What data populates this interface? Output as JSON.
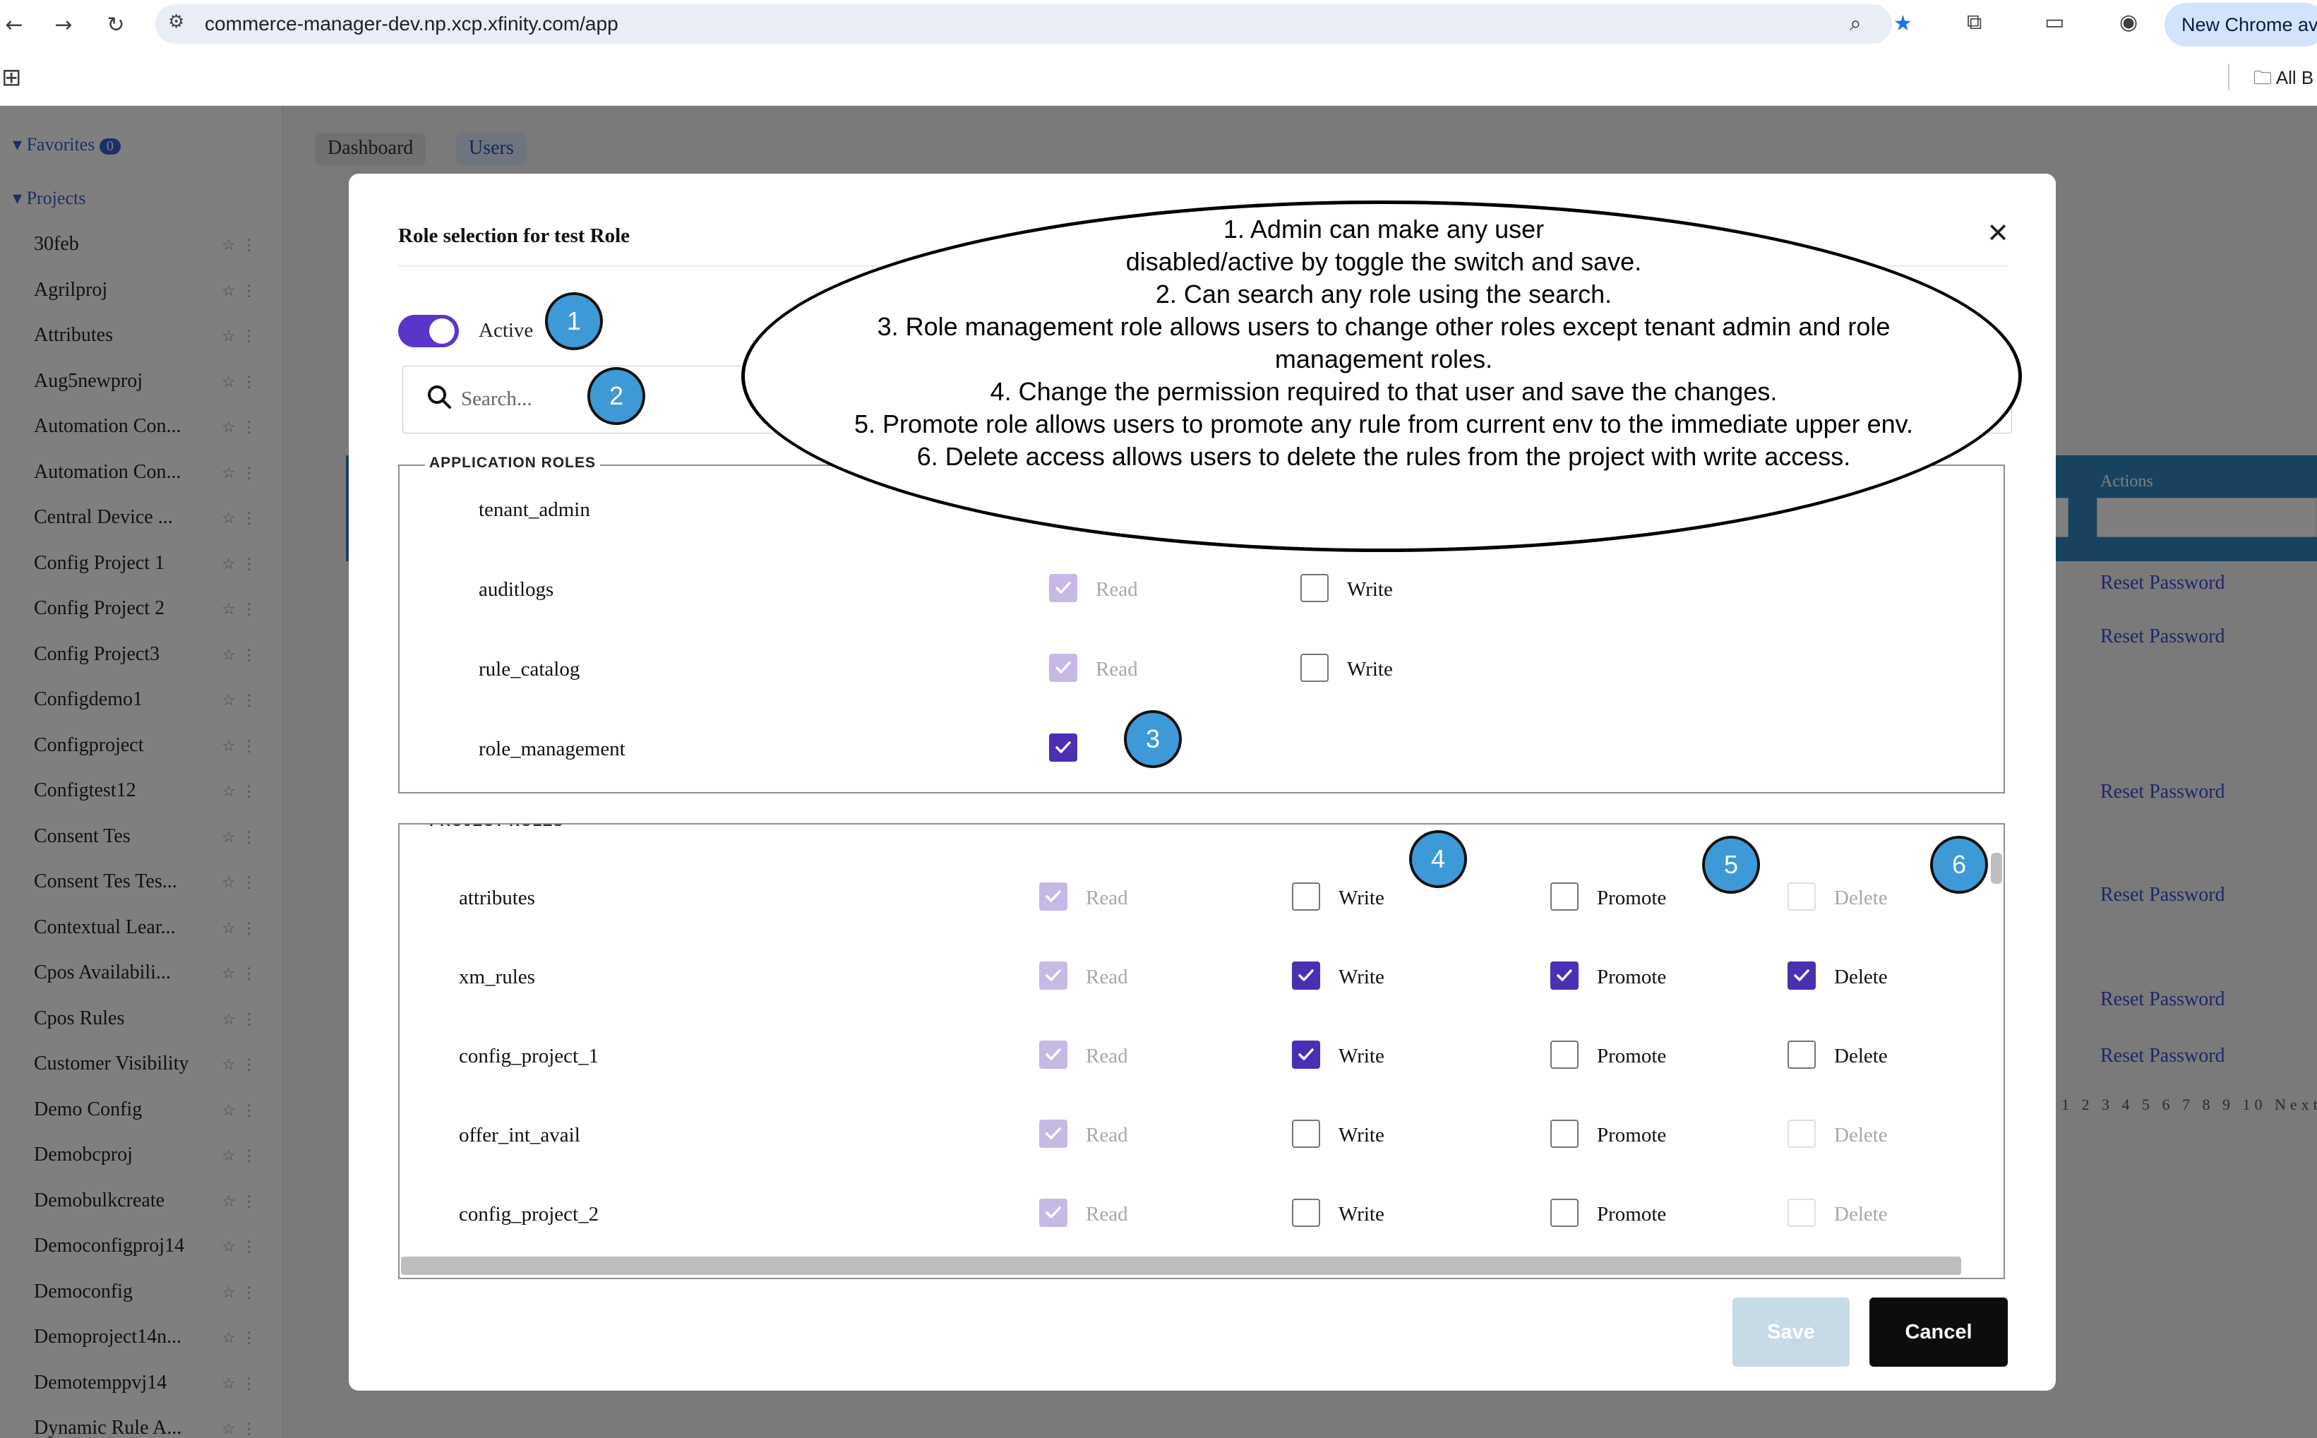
{
  "browser": {
    "url": "commerce-manager-dev.np.xcp.xfinity.com/app",
    "new_chrome_label": "New Chrome av",
    "all_bookmarks_label": "All B"
  },
  "background": {
    "sidebar": {
      "favorites_label": "Favorites",
      "favorites_count": "0",
      "projects_label": "Projects",
      "items": [
        "30feb",
        "Agrilproj",
        "Attributes",
        "Aug5newproj",
        "Automation Con...",
        "Automation Con...",
        "Central Device ...",
        "Config Project 1",
        "Config Project 2",
        "Config Project3",
        "Configdemo1",
        "Configproject",
        "Configtest12",
        "Consent Tes",
        "Consent Tes Tes...",
        "Contextual Lear...",
        "Cpos Availabili...",
        "Cpos Rules",
        "Customer Visibility",
        "Demo Config",
        "Demobcproj",
        "Demobulkcreate",
        "Democonfigproj14",
        "Democonfig",
        "Demoproject14n...",
        "Demotemppvj14",
        "Dynamic Rule A..."
      ]
    },
    "tabs": [
      "Dashboard",
      "Users"
    ],
    "actions_header": "Actions",
    "reset_link": "Reset Password",
    "pager": "1 2 3 4 5 6 7 8 9 10  Next"
  },
  "modal": {
    "title": "Role selection for test Role",
    "active_label": "Active",
    "search_placeholder": "Search...",
    "application_roles_legend": "APPLICATION ROLES",
    "project_roles_legend": "PROJECT ROLES",
    "labels": {
      "read": "Read",
      "write": "Write",
      "promote": "Promote",
      "delete": "Delete"
    },
    "application_roles": [
      {
        "name": "tenant_admin"
      },
      {
        "name": "auditlogs",
        "read": "checked-disabled",
        "write": "unchecked"
      },
      {
        "name": "rule_catalog",
        "read": "checked-disabled",
        "write": "unchecked"
      },
      {
        "name": "role_management",
        "single": "checked"
      }
    ],
    "project_roles": [
      {
        "name": "attributes",
        "read": "checked-disabled",
        "write": "unchecked",
        "promote": "unchecked",
        "delete": "disabled"
      },
      {
        "name": "xm_rules",
        "read": "checked-disabled",
        "write": "checked",
        "promote": "checked",
        "delete": "checked"
      },
      {
        "name": "config_project_1",
        "read": "checked-disabled",
        "write": "checked",
        "promote": "unchecked",
        "delete": "unchecked"
      },
      {
        "name": "offer_int_avail",
        "read": "checked-disabled",
        "write": "unchecked",
        "promote": "unchecked",
        "delete": "disabled"
      },
      {
        "name": "config_project_2",
        "read": "checked-disabled",
        "write": "unchecked",
        "promote": "unchecked",
        "delete": "disabled"
      }
    ],
    "save_label": "Save",
    "cancel_label": "Cancel"
  },
  "annotations": {
    "badges": [
      "1",
      "2",
      "3",
      "4",
      "5",
      "6"
    ],
    "lines": [
      "1. Admin can make any user",
      "disabled/active by toggle the switch and save.",
      "2. Can search any role using the search.",
      "3. Role management role allows users to change other roles except tenant admin and role",
      "management roles.",
      "4. Change the permission required to that user and save the changes.",
      "5. Promote role allows users to promote any rule from current env to the immediate upper env.",
      "6. Delete access allows users to delete the rules from the project with write access."
    ]
  },
  "colors": {
    "accent_purple": "#4a2fb5",
    "badge_blue": "#3d9ad6",
    "cancel_black": "#0d0d0d",
    "save_disabled": "#c7dbe6"
  }
}
